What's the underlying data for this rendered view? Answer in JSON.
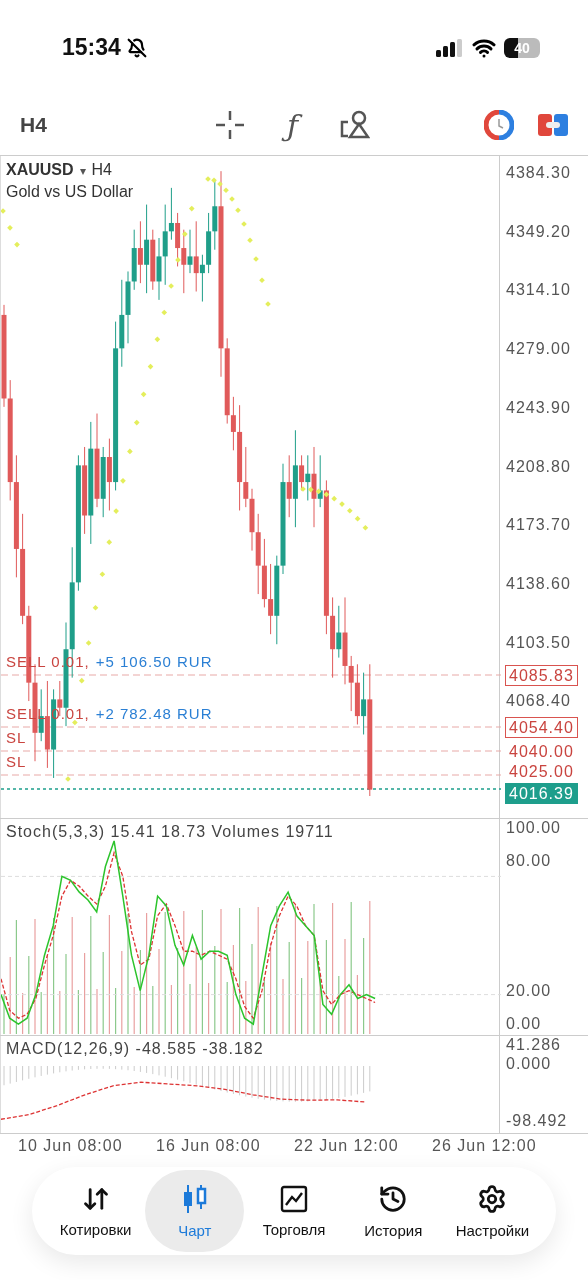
{
  "status_bar": {
    "time": "15:34",
    "muted": true,
    "battery": "40"
  },
  "toolbar": {
    "timeframe": "H4",
    "function_glyph": "ƒ"
  },
  "chart": {
    "symbol": "XAUUSD",
    "symbol_caret": "▾",
    "timeframe": "H4",
    "description": "Gold vs US Dollar",
    "price_labels": [
      "4384.30",
      "4349.20",
      "4314.10",
      "4279.00",
      "4243.90",
      "4208.80",
      "4173.70",
      "4138.60",
      "4103.50",
      "4068.40"
    ],
    "order_lines": [
      {
        "kind": "position",
        "label": "SELL 0.01,",
        "profit": "+5 106.50 RUR",
        "price": "4085.83"
      },
      {
        "kind": "position",
        "label": "SELL 0.01,",
        "profit": "+2 782.48 RUR",
        "price": "4054.40"
      },
      {
        "kind": "stop",
        "label": "SL",
        "price": "4040.00"
      },
      {
        "kind": "stop",
        "label": "SL",
        "price": "4025.00"
      }
    ],
    "current_price": "4016.39"
  },
  "stochastic": {
    "title": "Stoch(5,3,3) 15.41 18.73 Volumes 19711",
    "levels": [
      "100.00",
      "80.00",
      "20.00",
      "0.00"
    ]
  },
  "macd": {
    "title": "MACD(12,26,9) -48.585 -38.182",
    "levels": [
      "41.286",
      "0.000",
      "-98.492"
    ]
  },
  "time_axis": [
    "10 Jun 08:00",
    "16 Jun 08:00",
    "22 Jun 12:00",
    "26 Jun 12:00"
  ],
  "tabs": [
    {
      "label": "Котировки",
      "selected": false
    },
    {
      "label": "Чарт",
      "selected": true
    },
    {
      "label": "Торговля",
      "selected": false
    },
    {
      "label": "История",
      "selected": false
    },
    {
      "label": "Настройки",
      "selected": false
    }
  ]
}
